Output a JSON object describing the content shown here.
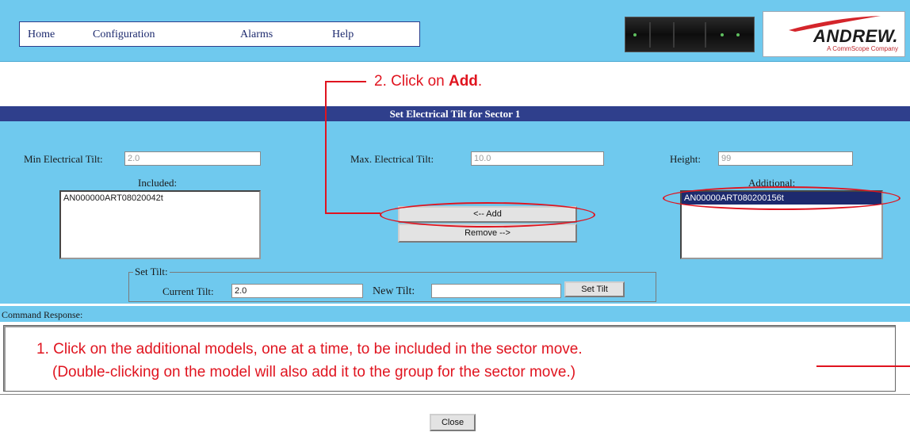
{
  "menu": {
    "home": "Home",
    "configuration": "Configuration",
    "alarms": "Alarms",
    "help": "Help"
  },
  "logo": {
    "brand": "ANDREW.",
    "tagline": "A CommScope Company"
  },
  "dialog": {
    "title": "Set Electrical Tilt for Sector 1",
    "min_tilt_label": "Min Electrical Tilt:",
    "min_tilt_value": "2.0",
    "max_tilt_label": "Max. Electrical Tilt:",
    "max_tilt_value": "10.0",
    "height_label": "Height:",
    "height_value": "99",
    "included_label": "Included:",
    "included_items": [
      "AN000000ART08020042t"
    ],
    "additional_label": "Additional:",
    "additional_items": [
      "AN00000ART080200156t"
    ],
    "add_button": "<-- Add",
    "remove_button": "Remove -->",
    "set_tilt_legend": "Set Tilt:",
    "current_tilt_label": "Current Tilt:",
    "current_tilt_value": "2.0",
    "new_tilt_label": "New Tilt:",
    "new_tilt_value": "",
    "set_tilt_button": "Set Tilt",
    "command_response_label": "Command Response:",
    "close_button": "Close"
  },
  "annotations": {
    "step2_prefix": "2.  Click on ",
    "step2_bold": "Add",
    "step2_suffix": ".",
    "step1_line1": "1.  Click on the additional models, one at a time, to be included in the sector move.",
    "step1_line2": "(Double-clicking on the model will also add it to the group for the sector move.)"
  },
  "colors": {
    "header_bg": "#6fc9ee",
    "title_bar": "#2f3f8c",
    "annotation": "#e0141f",
    "selection": "#1d2a6e"
  }
}
